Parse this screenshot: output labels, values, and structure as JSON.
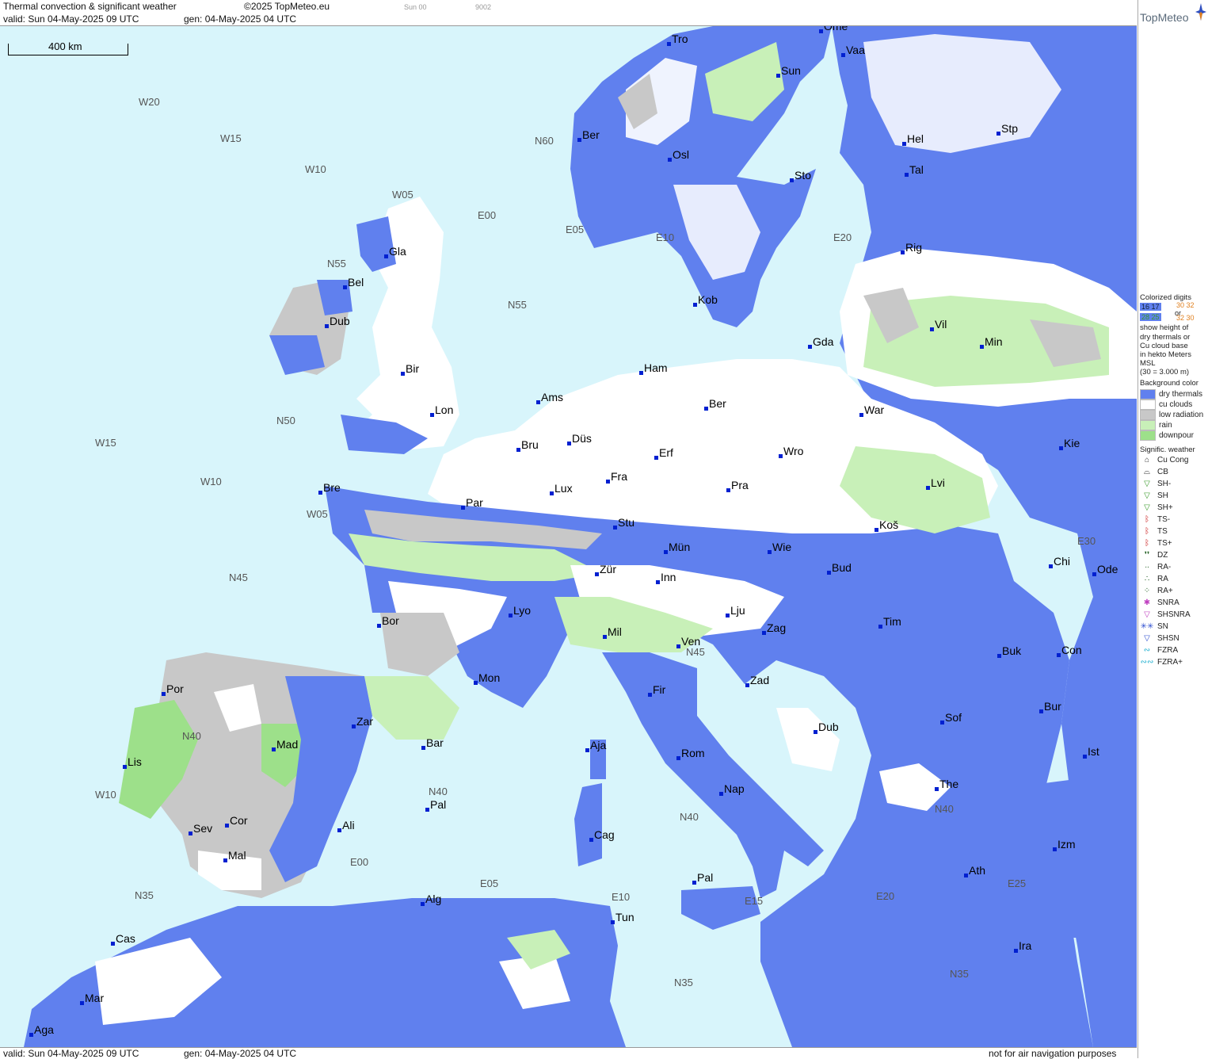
{
  "header": {
    "title": "Thermal convection & significant weather",
    "copyright": "©2025 TopMeteo.eu",
    "valid": "valid:  Sun  04-May-2025  09 UTC",
    "gen": "gen: 04-May-2025 04 UTC",
    "frame": "Sun 00",
    "code": "9002"
  },
  "footer": {
    "valid": "valid:  Sun  04-May-2025  09 UTC",
    "gen": "gen: 04-May-2025 04 UTC",
    "disclaimer": "not for air navigation purposes"
  },
  "map": {
    "scale_label": "400 km",
    "colors": {
      "sea": "#d8f5fb",
      "dry_thermals": "#6080ee",
      "cu_clouds": "#ffffff",
      "low_radiation": "#c8c8c8",
      "rain": "#c8f0b8",
      "downpour": "#9de08a"
    },
    "cities": [
      {
        "name": "Tro"
      },
      {
        "name": "Ome"
      },
      {
        "name": "Vaa"
      },
      {
        "name": "Sun"
      },
      {
        "name": "Ber"
      },
      {
        "name": "Osl"
      },
      {
        "name": "Sto"
      },
      {
        "name": "Hel"
      },
      {
        "name": "Stp"
      },
      {
        "name": "Tal"
      },
      {
        "name": "Rig"
      },
      {
        "name": "Gla"
      },
      {
        "name": "Bel"
      },
      {
        "name": "Dub"
      },
      {
        "name": "Kob"
      },
      {
        "name": "Vil"
      },
      {
        "name": "Min"
      },
      {
        "name": "Gda"
      },
      {
        "name": "Bir"
      },
      {
        "name": "Ham"
      },
      {
        "name": "Ams"
      },
      {
        "name": "Lon"
      },
      {
        "name": "Ber"
      },
      {
        "name": "War"
      },
      {
        "name": "Düs"
      },
      {
        "name": "Bru"
      },
      {
        "name": "Erf"
      },
      {
        "name": "Wro"
      },
      {
        "name": "Kie"
      },
      {
        "name": "Lux"
      },
      {
        "name": "Fra"
      },
      {
        "name": "Pra"
      },
      {
        "name": "Lvi"
      },
      {
        "name": "Bre"
      },
      {
        "name": "Par"
      },
      {
        "name": "Stu"
      },
      {
        "name": "Koš"
      },
      {
        "name": "Mün"
      },
      {
        "name": "Wie"
      },
      {
        "name": "Chi"
      },
      {
        "name": "Ode"
      },
      {
        "name": "Zür"
      },
      {
        "name": "Inn"
      },
      {
        "name": "Bud"
      },
      {
        "name": "Lyo"
      },
      {
        "name": "Bor"
      },
      {
        "name": "Lju"
      },
      {
        "name": "Tim"
      },
      {
        "name": "Mil"
      },
      {
        "name": "Zag"
      },
      {
        "name": "Ven"
      },
      {
        "name": "Buk"
      },
      {
        "name": "Con"
      },
      {
        "name": "Mon"
      },
      {
        "name": "Por"
      },
      {
        "name": "Zad"
      },
      {
        "name": "Fir"
      },
      {
        "name": "Bur"
      },
      {
        "name": "Zar"
      },
      {
        "name": "Sof"
      },
      {
        "name": "Dub"
      },
      {
        "name": "Bar"
      },
      {
        "name": "Aja"
      },
      {
        "name": "Mad"
      },
      {
        "name": "Rom"
      },
      {
        "name": "Ist"
      },
      {
        "name": "Lis"
      },
      {
        "name": "The"
      },
      {
        "name": "Nap"
      },
      {
        "name": "Pal"
      },
      {
        "name": "Cag"
      },
      {
        "name": "Sev"
      },
      {
        "name": "Cor"
      },
      {
        "name": "Ali"
      },
      {
        "name": "Izm"
      },
      {
        "name": "Mal"
      },
      {
        "name": "Ath"
      },
      {
        "name": "Pal"
      },
      {
        "name": "Alg"
      },
      {
        "name": "Tun"
      },
      {
        "name": "Cas"
      },
      {
        "name": "Ira"
      },
      {
        "name": "Mar"
      },
      {
        "name": "Aga"
      }
    ],
    "grid_labels": [
      {
        "text": "W20"
      },
      {
        "text": "W15"
      },
      {
        "text": "W10"
      },
      {
        "text": "W05"
      },
      {
        "text": "E00"
      },
      {
        "text": "E05"
      },
      {
        "text": "E10"
      },
      {
        "text": "E20"
      },
      {
        "text": "N60"
      },
      {
        "text": "N55"
      },
      {
        "text": "N55"
      },
      {
        "text": "N50"
      },
      {
        "text": "W15"
      },
      {
        "text": "W10"
      },
      {
        "text": "W05"
      },
      {
        "text": "N45"
      },
      {
        "text": "N40"
      },
      {
        "text": "W10"
      },
      {
        "text": "N40"
      },
      {
        "text": "N40"
      },
      {
        "text": "E00"
      },
      {
        "text": "E05"
      },
      {
        "text": "E10"
      },
      {
        "text": "E15"
      },
      {
        "text": "E20"
      },
      {
        "text": "E25"
      },
      {
        "text": "N35"
      },
      {
        "text": "N35"
      },
      {
        "text": "N35"
      },
      {
        "text": "N45"
      },
      {
        "text": "E30"
      },
      {
        "text": "N40"
      }
    ]
  },
  "legend": {
    "logo_text": "TopMeteo",
    "colorized_title": "Colorized digits",
    "sample_a": "16 17",
    "sample_or": "or",
    "sample_b": "30 32",
    "sample_c": "28 25",
    "sample_d": "32 30",
    "desc1": "show height of",
    "desc2": "dry thermals or",
    "desc3": "Cu cloud base",
    "desc4": "in hekto Meters",
    "desc5": "MSL",
    "desc6": "(30 = 3.000 m)",
    "bg_title": "Background color",
    "bg_items": [
      {
        "label": "dry thermals",
        "color": "#6080ee"
      },
      {
        "label": "cu clouds",
        "color": "#ffffff"
      },
      {
        "label": "low radiation",
        "color": "#c8c8c8"
      },
      {
        "label": "rain",
        "color": "#c8f0b8"
      },
      {
        "label": "downpour",
        "color": "#9de08a"
      }
    ],
    "sig_title": "Signific. weather",
    "sig_items": [
      {
        "label": "Cu Cong",
        "symbol": "⌂",
        "color": "#333"
      },
      {
        "label": "CB",
        "symbol": "⌓",
        "color": "#333"
      },
      {
        "label": "SH-",
        "symbol": "▽",
        "color": "#3a9a2a"
      },
      {
        "label": "SH",
        "symbol": "▽",
        "color": "#3a9a2a"
      },
      {
        "label": "SH+",
        "symbol": "▽",
        "color": "#3a9a2a"
      },
      {
        "label": "TS-",
        "symbol": "ᛒ",
        "color": "#cc2222"
      },
      {
        "label": "TS",
        "symbol": "ᛒ",
        "color": "#cc2222"
      },
      {
        "label": "TS+",
        "symbol": "ᛒ",
        "color": "#cc2222"
      },
      {
        "label": "DZ",
        "symbol": "❜❜",
        "color": "#1a5a1a"
      },
      {
        "label": "RA-",
        "symbol": "∙∙",
        "color": "#1a5a1a"
      },
      {
        "label": "RA",
        "symbol": "∴",
        "color": "#1a5a1a"
      },
      {
        "label": "RA+",
        "symbol": "⁘",
        "color": "#1a5a1a"
      },
      {
        "label": "SNRA",
        "symbol": "✱",
        "color": "#c040c0"
      },
      {
        "label": "SHSNRA",
        "symbol": "▽",
        "color": "#c040c0"
      },
      {
        "label": "SN",
        "symbol": "✳✳",
        "color": "#3050d0"
      },
      {
        "label": "SHSN",
        "symbol": "▽",
        "color": "#3050d0"
      },
      {
        "label": "FZRA",
        "symbol": "∾",
        "color": "#20b0d0"
      },
      {
        "label": "FZRA+",
        "symbol": "∾∾",
        "color": "#20b0d0"
      }
    ]
  }
}
